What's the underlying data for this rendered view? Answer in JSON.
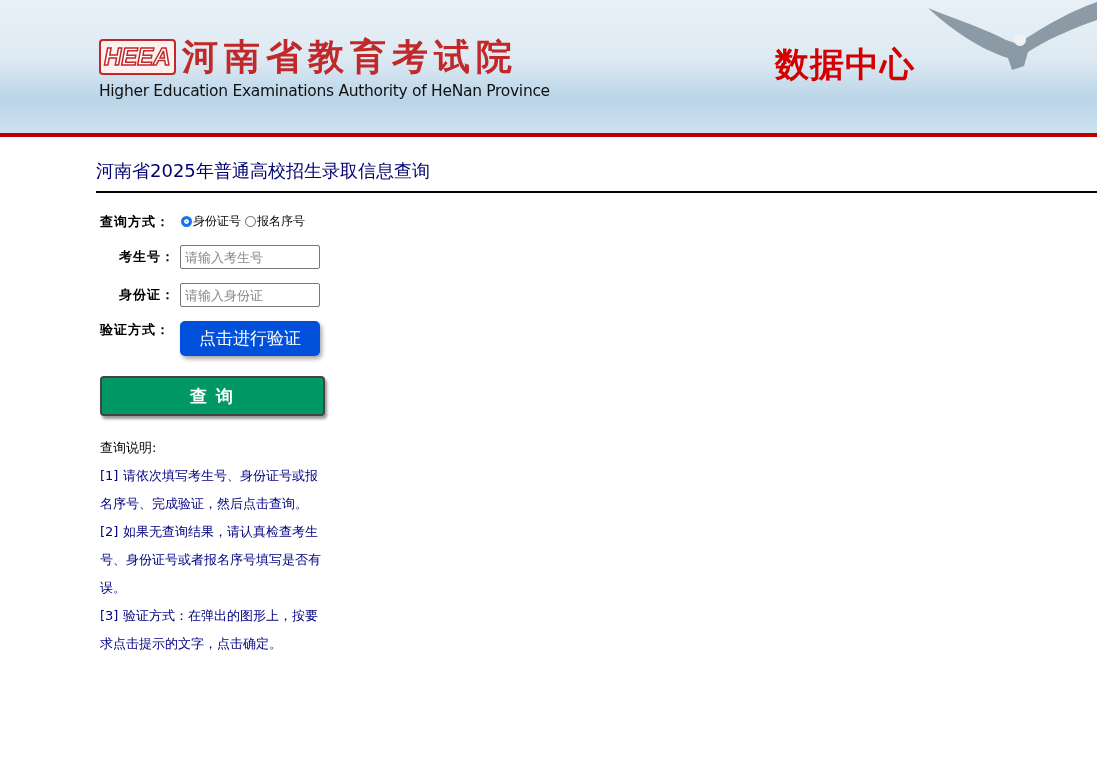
{
  "header": {
    "logo_mark": "HEEA",
    "org_name": "河南省教育考试院",
    "org_name_en": "Higher Education Examinations Authority of HeNan Province",
    "section_title": "数据中心"
  },
  "page_title": "河南省2025年普通高校招生录取信息查询",
  "form": {
    "fields": [
      {
        "kind": "radio",
        "label": "查询方式：",
        "options": [
          {
            "label": "身份证号",
            "selected": true
          },
          {
            "label": "报名序号",
            "selected": false
          }
        ]
      },
      {
        "kind": "input",
        "label": "考生号：",
        "placeholder": "请输入考生号"
      },
      {
        "kind": "input",
        "label": "身份证：",
        "placeholder": "请输入身份证"
      },
      {
        "kind": "button",
        "label": "验证方式：",
        "button_label": "点击进行验证"
      }
    ],
    "submit": "查 询"
  },
  "notes": {
    "heading": "查询说明:",
    "items": [
      "[1] 请依次填写考生号、身份证号或报名序号、完成验证，然后点击查询。",
      "[2] 如果无查询结果，请认真检查考生号、身份证号或者报名序号填写是否有误。",
      "[3] 验证方式：在弹出的图形上，按要求点击提示的文字，点击确定。"
    ]
  }
}
